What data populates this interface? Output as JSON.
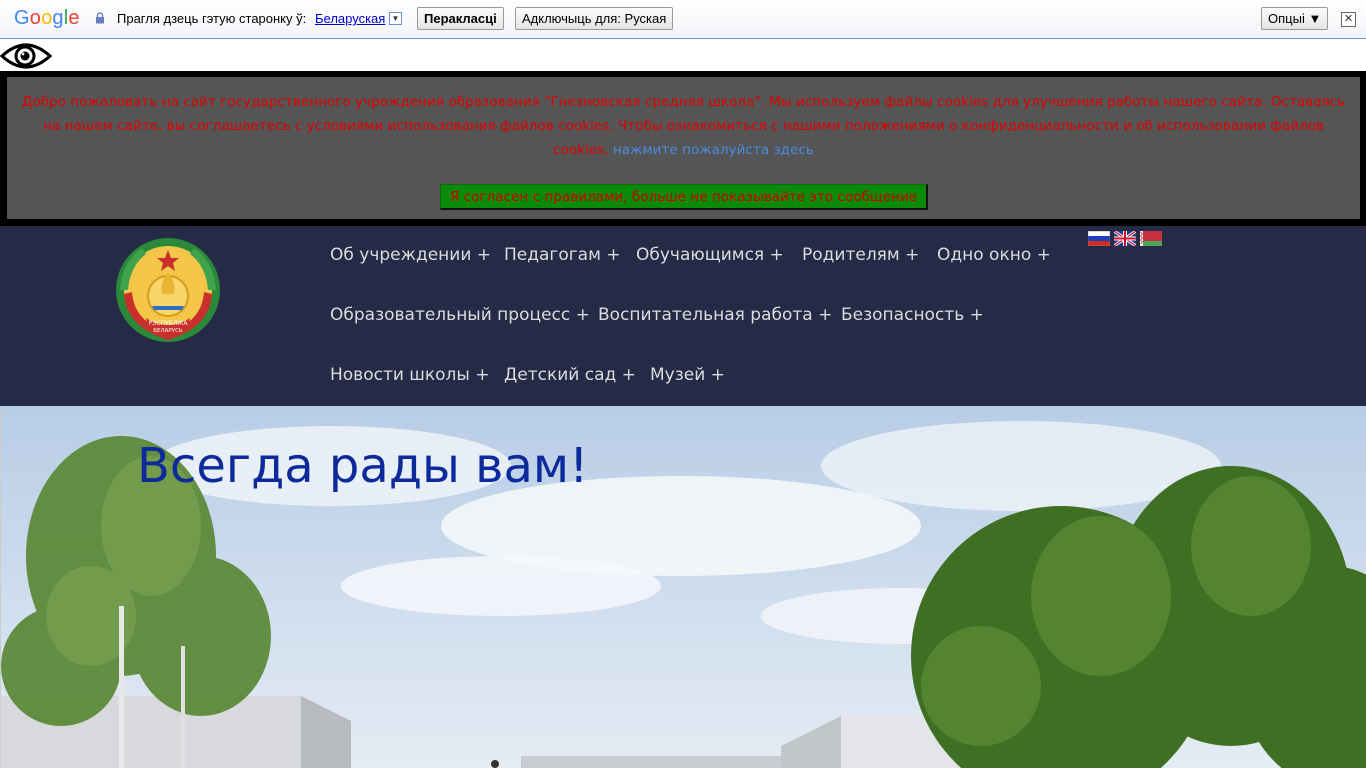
{
  "translate_bar": {
    "logo": "Google",
    "prompt": "Прагля дзець гэтую старонку ў:",
    "language": "Беларуская",
    "translate_button": "Перакласці",
    "disable_button": "Адключыць для: Руская",
    "options_button": "Опцыі ▼",
    "close": "✕"
  },
  "cookie_banner": {
    "text": "Добро пожаловать на сайт государственного учреждения образования \"Гнезновская средняя школа\". Мы используем файлы cookies для улучшения работы нашего сайта. Оставаясь на нашем сайте, вы соглашаетесь с условиями использования файлов cookies. Чтобы ознакомиться с нашими положениями о конфиденциальности и об использовании файлов cookies,",
    "link": "нажмите пожалуйста здесь",
    "accept_button": "Я согласен с правилами, больше не показывайте это сообщение"
  },
  "nav": {
    "items": [
      "Об учреждении +",
      "Педагогам +",
      "Обучающимся +",
      "Родителям +",
      "Одно окно +",
      "Образовательный процесс +",
      "Воспитательная работа +",
      "Безопасность +",
      "Новости школы +",
      "Детский сад +",
      "Музей +"
    ]
  },
  "emblem": {
    "ribbon_text_1": "РЭСПУБЛІКА",
    "ribbon_text_2": "БЕЛАРУСЬ"
  },
  "languages": [
    "ru",
    "en",
    "be"
  ],
  "hero": {
    "title": "Всегда рады вам!"
  },
  "colors": {
    "header_bg": "#252a47",
    "cookie_text": "#e00000",
    "cookie_link": "#4a8ae0",
    "accept_bg": "#0a8a0a",
    "hero_title": "#0d2a9c"
  }
}
